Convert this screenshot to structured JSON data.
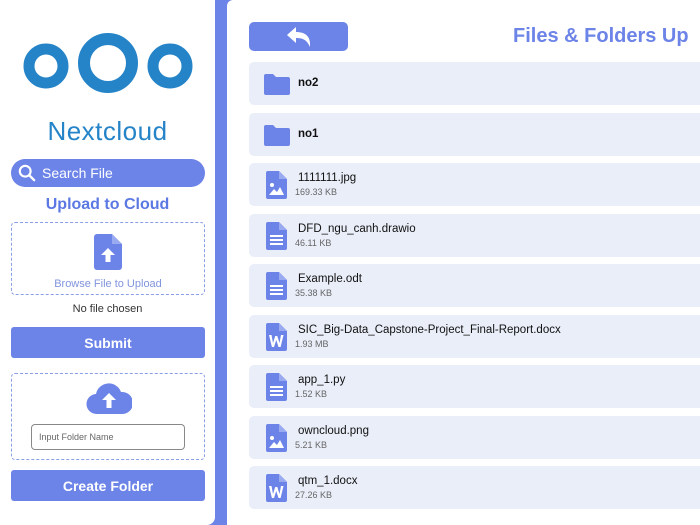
{
  "colors": {
    "accent": "#6c83e8",
    "logo": "#2584c8",
    "row_bg": "#eaeef9"
  },
  "sidebar": {
    "logo_text": "Nextcloud",
    "search_placeholder": "Search File",
    "upload_title": "Upload to Cloud",
    "browse_label": "Browse File to Upload",
    "no_file_text": "No file chosen",
    "submit_label": "Submit",
    "folder_input_placeholder": "Input Folder Name",
    "create_folder_label": "Create Folder"
  },
  "main": {
    "title": "Files & Folders Up",
    "back_icon": "back-arrow-icon",
    "items": [
      {
        "type": "folder",
        "name": "no2",
        "size": "",
        "icon": "folder-icon"
      },
      {
        "type": "folder",
        "name": "no1",
        "size": "",
        "icon": "folder-icon"
      },
      {
        "type": "file",
        "name": "1111111.jpg",
        "size": "169.33 KB",
        "icon": "image-file-icon"
      },
      {
        "type": "file",
        "name": "DFD_ngu_canh.drawio",
        "size": "46.11 KB",
        "icon": "text-file-icon"
      },
      {
        "type": "file",
        "name": "Example.odt",
        "size": "35.38 KB",
        "icon": "text-file-icon"
      },
      {
        "type": "file",
        "name": "SIC_Big-Data_Capstone-Project_Final-Report.docx",
        "size": "1.93 MB",
        "icon": "word-file-icon"
      },
      {
        "type": "file",
        "name": "app_1.py",
        "size": "1.52 KB",
        "icon": "text-file-icon"
      },
      {
        "type": "file",
        "name": "owncloud.png",
        "size": "5.21 KB",
        "icon": "image-file-icon"
      },
      {
        "type": "file",
        "name": "qtm_1.docx",
        "size": "27.26 KB",
        "icon": "word-file-icon"
      }
    ]
  }
}
